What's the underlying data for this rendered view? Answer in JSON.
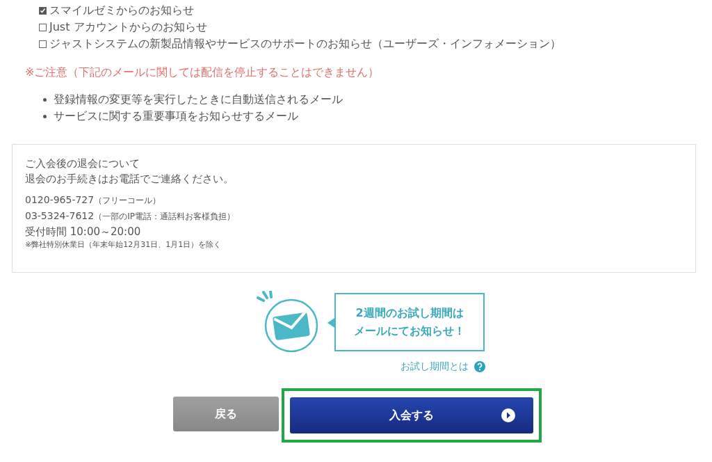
{
  "subscriptions": [
    {
      "label": "スマイルゼミからのお知らせ",
      "checked": true
    },
    {
      "label": "Just アカウントからのお知らせ",
      "checked": false
    },
    {
      "label": "ジャストシステムの新製品情報やサービスのサポートのお知らせ（ユーザーズ・インフォメーション）",
      "checked": false
    }
  ],
  "notice": "※ご注意（下記のメールに関しては配信を停止することはできません）",
  "mandatory_mails": [
    "登録情報の変更等を実行したときに自動送信されるメール",
    "サービスに関する重要事項をお知らせするメール"
  ],
  "withdrawal": {
    "heading": "ご入会後の退会について",
    "text": "退会のお手続きはお電話でご連絡ください。",
    "phones": [
      {
        "number": "0120-965-727",
        "note": "（フリーコール）"
      },
      {
        "number": "03-5324-7612",
        "note": "（一部のIP電話：通話料お客様負担）"
      }
    ],
    "hours": "受付時間 10:00～20:00",
    "footnote": "※弊社特別休業日（年末年始12月31日、1月1日）を除く"
  },
  "trial_banner": {
    "line1": "2週間のお試し期間は",
    "line2": "メールにてお知らせ！"
  },
  "trial_link": "お試し期間とは",
  "buttons": {
    "back": "戻る",
    "join": "入会する",
    "join_highlighted": true
  }
}
